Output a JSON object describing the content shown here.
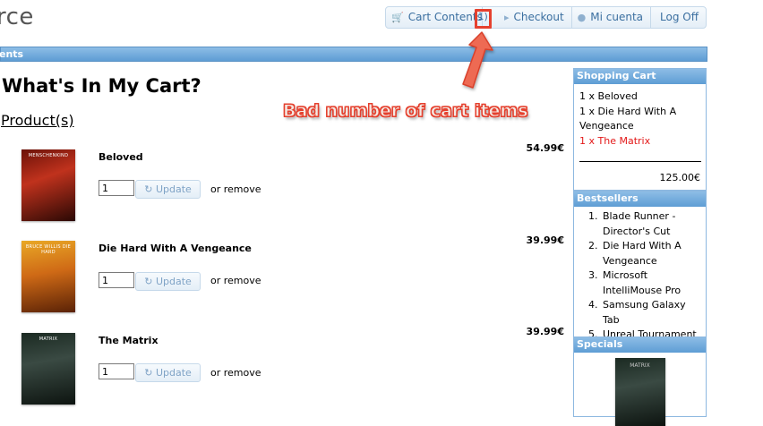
{
  "header": {
    "logo_text": "rce",
    "nav": [
      {
        "label": "Cart Contents",
        "icon": "cart-icon"
      },
      {
        "label": "Checkout",
        "icon": "play-arrow-icon"
      },
      {
        "label": "Mi cuenta",
        "icon": "user-icon"
      },
      {
        "label": "Log Off",
        "icon": ""
      }
    ],
    "cart_count": "(1)"
  },
  "breadcrumb_bar": {
    "text": "ents"
  },
  "main": {
    "title": "What's In My Cart?",
    "products_heading": "Product(s)",
    "update_label": "Update",
    "or_remove": "or remove",
    "items": [
      {
        "name": "Beloved",
        "qty": "1",
        "price": "54.99€",
        "cover_text": "MENSCHENKIND"
      },
      {
        "name": "Die Hard With A Vengeance",
        "qty": "1",
        "price": "39.99€",
        "cover_text": "BRUCE WILLIS DIE HARD"
      },
      {
        "name": "The Matrix",
        "qty": "1",
        "price": "39.99€",
        "cover_text": "MATRIX"
      }
    ]
  },
  "sidebar": {
    "shopping_cart": {
      "title": "Shopping Cart",
      "items": [
        "1 x Beloved",
        "1 x Die Hard With A Vengeance",
        "1 x The Matrix"
      ],
      "total": "125.00€"
    },
    "bestsellers": {
      "title": "Bestsellers",
      "items": [
        "Blade Runner - Director's Cut",
        "Die Hard With A Vengeance",
        "Microsoft IntelliMouse Pro",
        "Samsung Galaxy Tab",
        "Unreal Tournament"
      ]
    },
    "specials": {
      "title": "Specials",
      "cover_text": "MATRIX"
    }
  },
  "annotation": {
    "text": "Bad number of cart items"
  },
  "colors": {
    "accent": "#5e9dd4",
    "annotation": "#e5402e",
    "active_item": "#e31919"
  }
}
